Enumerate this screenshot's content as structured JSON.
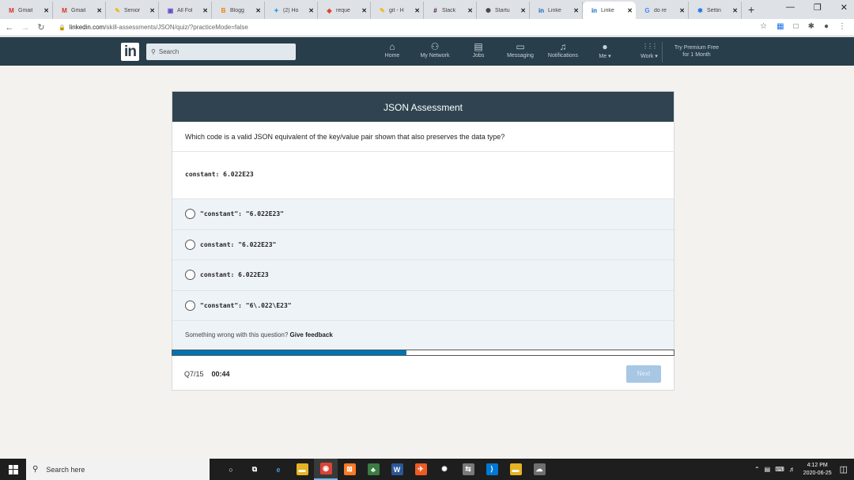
{
  "browser": {
    "tabs": [
      {
        "label": "Gmail",
        "icon": "gmail-icon",
        "glyph": "M",
        "color": "#d93025"
      },
      {
        "label": "Gmail",
        "icon": "gmail-icon",
        "glyph": "M",
        "color": "#d93025"
      },
      {
        "label": "Senior",
        "icon": "pen-icon",
        "glyph": "✎",
        "color": "#f4b400"
      },
      {
        "label": "All Fol",
        "icon": "folder-app-icon",
        "glyph": "▣",
        "color": "#5e4dbe"
      },
      {
        "label": "Blogg",
        "icon": "blogger-icon",
        "glyph": "B",
        "color": "#f57d00"
      },
      {
        "label": "(2) Ho",
        "icon": "twitter-icon",
        "glyph": "✦",
        "color": "#1da1f2"
      },
      {
        "label": "reque",
        "icon": "gitlab-icon",
        "glyph": "◆",
        "color": "#e24329"
      },
      {
        "label": "git - H",
        "icon": "pen-icon",
        "glyph": "✎",
        "color": "#f4b400"
      },
      {
        "label": "Slack",
        "icon": "slack-icon",
        "glyph": "#",
        "color": "#4a154b"
      },
      {
        "label": "Startu",
        "icon": "startup-icon",
        "glyph": "✺",
        "color": "#444444"
      },
      {
        "label": "Linke",
        "icon": "linkedin-icon",
        "glyph": "in",
        "color": "#0a66c2"
      },
      {
        "label": "Linke",
        "icon": "linkedin-icon",
        "glyph": "in",
        "color": "#0a66c2",
        "active": true
      },
      {
        "label": "do re",
        "icon": "google-icon",
        "glyph": "G",
        "color": "#4285f4"
      },
      {
        "label": "Settin",
        "icon": "gear-icon",
        "glyph": "✱",
        "color": "#1a73e8"
      }
    ],
    "new_tab": "+",
    "url_host": "linkedin.com",
    "url_path": "/skill-assessments/JSON/quiz/?practiceMode=false"
  },
  "nav": {
    "logo": "in",
    "search_placeholder": "Search",
    "items": [
      {
        "label": "Home",
        "icon": "home-icon",
        "glyph": "⌂"
      },
      {
        "label": "My Network",
        "icon": "network-icon",
        "glyph": "⚇"
      },
      {
        "label": "Jobs",
        "icon": "briefcase-icon",
        "glyph": "▤"
      },
      {
        "label": "Messaging",
        "icon": "messaging-icon",
        "glyph": "▭"
      },
      {
        "label": "Notifications",
        "icon": "bell-icon",
        "glyph": "♫"
      },
      {
        "label": "Me ▾",
        "icon": "avatar-icon",
        "glyph": "●"
      },
      {
        "label": "Work ▾",
        "icon": "grid-icon",
        "glyph": "⋮⋮⋮"
      }
    ],
    "premium_line1": "Try Premium Free",
    "premium_line2": "for 1 Month"
  },
  "quiz": {
    "title": "JSON Assessment",
    "question": "Which code is a valid JSON equivalent of the key/value pair shown that also preserves the data type?",
    "code": "constant: 6.022E23",
    "options": [
      "\"constant\": \"6.022E23\"",
      "constant: \"6.022E23\"",
      "constant: 6.022E23",
      "\"constant\": \"6\\.022\\E23\""
    ],
    "feedback_text": "Something wrong with this question?",
    "feedback_link": "Give feedback",
    "progress": 0.467,
    "question_count": "Q7/15",
    "timer": "00:44",
    "next_label": "Next"
  },
  "taskbar": {
    "search_placeholder": "Search here",
    "icons": [
      {
        "name": "cortana-icon",
        "glyph": "○",
        "bg": "transparent"
      },
      {
        "name": "task-view-icon",
        "glyph": "⧉",
        "bg": "transparent"
      },
      {
        "name": "edge-icon",
        "glyph": "e",
        "bg": "transparent",
        "color": "#3c9ee0"
      },
      {
        "name": "file-explorer-icon",
        "glyph": "▬",
        "bg": "#e6b422"
      },
      {
        "name": "chrome-icon",
        "glyph": "◉",
        "bg": "#db4437",
        "active": true
      },
      {
        "name": "xampp-icon",
        "glyph": "⊠",
        "bg": "#fb7a24"
      },
      {
        "name": "app-icon",
        "glyph": "♣",
        "bg": "#3a7d44"
      },
      {
        "name": "word-icon",
        "glyph": "W",
        "bg": "#2b579a"
      },
      {
        "name": "postman-icon",
        "glyph": "✈",
        "bg": "#ef5b25"
      },
      {
        "name": "settings-app-icon",
        "glyph": "✺",
        "bg": "transparent"
      },
      {
        "name": "teamviewer-icon",
        "glyph": "⇆",
        "bg": "#7a7a7a"
      },
      {
        "name": "vscode-icon",
        "glyph": "⟩",
        "bg": "#0078d4"
      },
      {
        "name": "folder-icon",
        "glyph": "▬",
        "bg": "#e6b422"
      },
      {
        "name": "chat-icon",
        "glyph": "☁",
        "bg": "#6f6f6f"
      }
    ],
    "time": "4:12 PM",
    "date": "2020-06-25"
  }
}
